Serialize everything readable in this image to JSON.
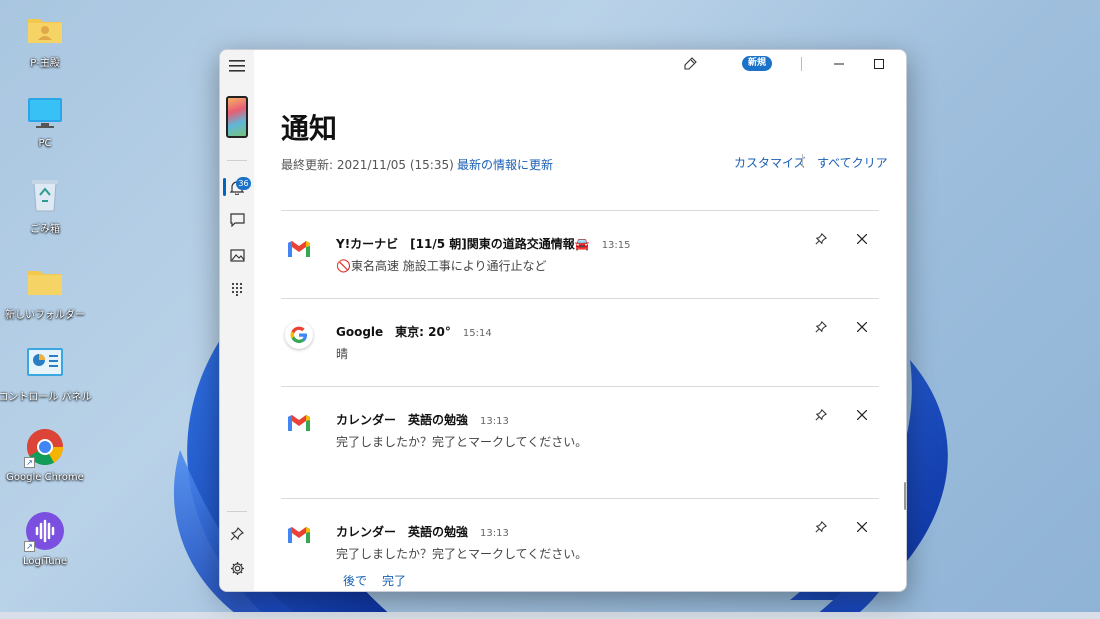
{
  "desktop": {
    "icons": [
      {
        "label": "P-主殿"
      },
      {
        "label": "PC"
      },
      {
        "label": "ごみ箱"
      },
      {
        "label": "新しいフォルダー"
      },
      {
        "label": "コントロール パネル"
      },
      {
        "label": "Google Chrome"
      },
      {
        "label": "LogiTune"
      }
    ]
  },
  "colors": {
    "accent": "#1a73c8",
    "link": "#1a5fb4"
  },
  "window": {
    "new_badge": "新規",
    "rail_badge_count": "36",
    "title": "通知",
    "last_updated": "最終更新: 2021/11/05 (15:35)",
    "refresh_link": "最新の情報に更新",
    "customize_link": "カスタマイズ",
    "clear_all_link": "すべてクリア",
    "notifications": [
      {
        "app_icon": "gmail-icon",
        "head": "Y!カーナビ　[11/5 朝]関東の道路交通情報🚘",
        "time": "13:15",
        "body": "🚫東名高速 施設工事により通行止など"
      },
      {
        "app_icon": "google-icon",
        "head": "Google　東京: 20°",
        "time": "15:14",
        "body": "晴"
      },
      {
        "app_icon": "gmail-icon",
        "head": "カレンダー　英語の勉強",
        "time": "13:13",
        "body": "完了しましたか？完了とマークしてください。"
      },
      {
        "app_icon": "gmail-icon",
        "head": "カレンダー　英語の勉強",
        "time": "13:13",
        "body": "完了しましたか？完了とマークしてください。",
        "actions": [
          "後で",
          "完了"
        ]
      }
    ]
  }
}
